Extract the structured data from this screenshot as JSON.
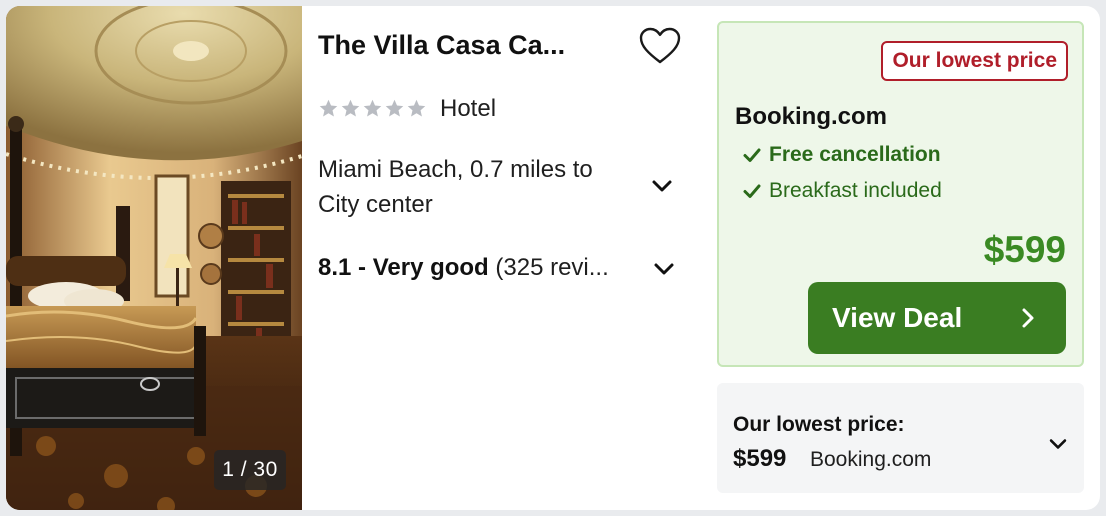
{
  "hotel": {
    "name": "The Villa Casa Ca...",
    "star_rating": 5,
    "property_type": "Hotel",
    "location": "Miami Beach, 0.7 miles to City center",
    "rating_score": "8.1 - Very good",
    "rating_reviews": "(325 revi...",
    "photo_counter": "1 / 30"
  },
  "deal": {
    "badge": "Our lowest price",
    "provider": "Booking.com",
    "amenities": [
      "Free cancellation",
      "Breakfast included"
    ],
    "price": "$599",
    "button_label": "View Deal"
  },
  "summary": {
    "heading": "Our lowest price:",
    "price": "$599",
    "provider": "Booking.com"
  },
  "colors": {
    "deal_green": "#3a7d22",
    "price_green": "#3a8a23",
    "badge_red": "#b01e2a",
    "deal_box_bg": "#eef7e9",
    "star_gray": "#b9bcc2"
  },
  "icons": {
    "favorite": "heart-outline-icon",
    "expand": "chevron-down-icon",
    "amenity": "checkmark-icon",
    "button": "chevron-right-icon"
  }
}
